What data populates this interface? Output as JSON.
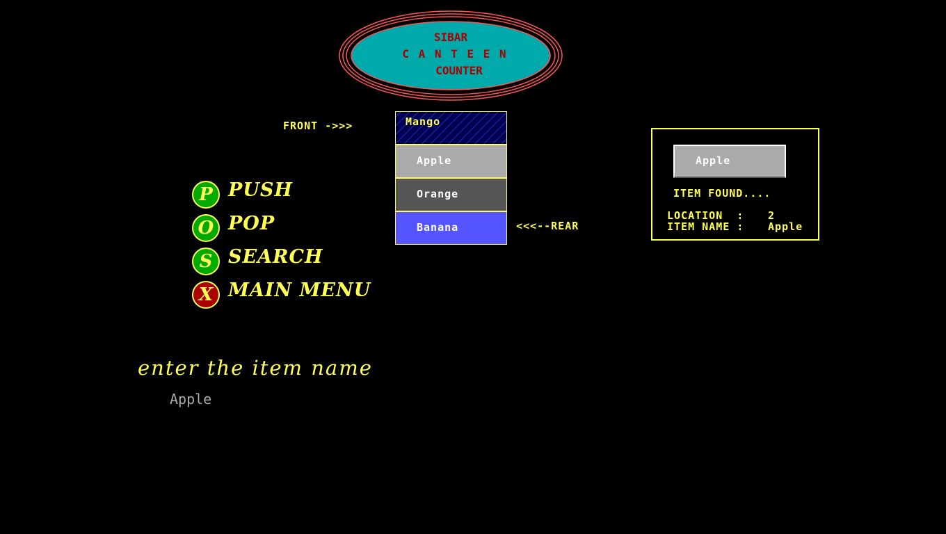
{
  "title": {
    "line1": "SIBAR",
    "line2": "C A N T E E N",
    "line3": "COUNTER"
  },
  "queue": {
    "front_label": "FRONT ->>>",
    "rear_label": "<<<--REAR",
    "items": [
      "Mango",
      "Apple",
      "Orange",
      "Banana"
    ]
  },
  "menu": [
    {
      "key": "P",
      "label": "PUSH"
    },
    {
      "key": "O",
      "label": "POP"
    },
    {
      "key": "S",
      "label": "SEARCH"
    },
    {
      "key": "X",
      "label": "MAIN MENU"
    }
  ],
  "prompt": {
    "text": "enter the item name",
    "entered_value": "Apple"
  },
  "result": {
    "item": "Apple",
    "status": "ITEM FOUND....",
    "location_label": "LOCATION  :",
    "location_value": "2",
    "name_label": "ITEM NAME :",
    "name_value": "Apple"
  },
  "colors": {
    "background": "#000000",
    "text_yellow": "#ffff55",
    "title_fill": "#00aaaa",
    "title_red": "#aa0000",
    "ring_red": "#ff5555",
    "push_green": "#00aa00",
    "exit_red": "#aa0000",
    "apple_gray": "#aaaaaa",
    "orange_darkgray": "#555555",
    "banana_blue": "#5555ff",
    "mango_navy": "#000050"
  }
}
